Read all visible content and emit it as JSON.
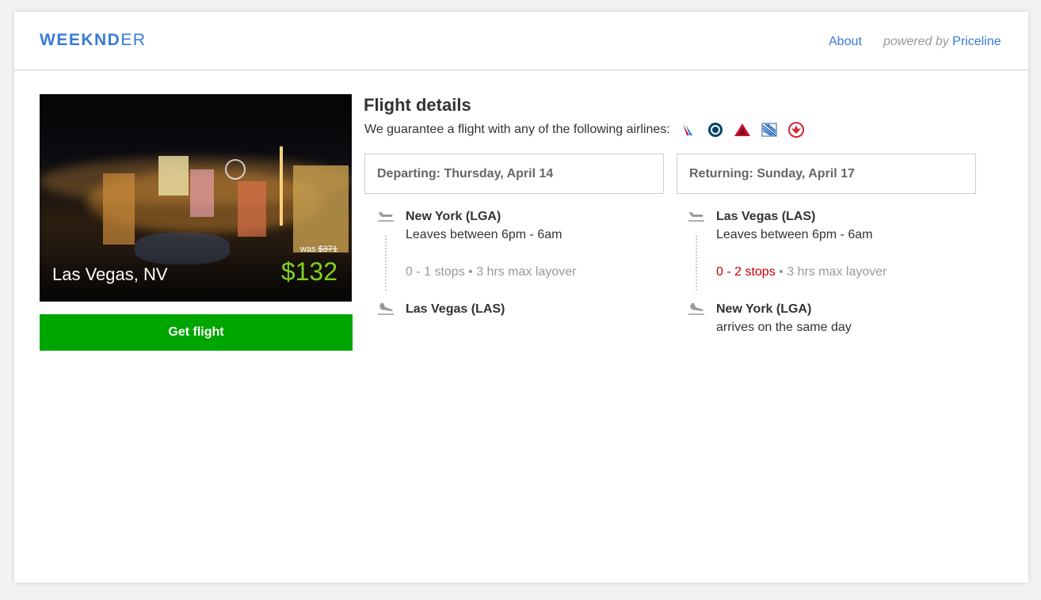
{
  "header": {
    "logo_bold": "WEEKND",
    "logo_light": "ER",
    "about_label": "About",
    "powered_by_prefix": "powered by",
    "powered_by_brand": "Priceline"
  },
  "deal": {
    "city": "Las Vegas, NV",
    "was_label": "was",
    "was_price": "$371",
    "price": "$132",
    "cta_label": "Get flight"
  },
  "flight_details": {
    "title": "Flight details",
    "guarantee_text": "We guarantee a flight with any of the following airlines:",
    "airline_icons": [
      "american-airlines-icon",
      "alaska-airlines-icon",
      "delta-icon",
      "united-icon",
      "air-canada-icon"
    ]
  },
  "departing": {
    "header": "Departing: Thursday, April 14",
    "origin": "New York (LGA)",
    "leaves": "Leaves between 6pm - 6am",
    "stops": "0 - 1 stops",
    "layover": " • 3 hrs max layover",
    "destination": "Las Vegas (LAS)"
  },
  "returning": {
    "header": "Returning: Sunday, April 17",
    "origin": "Las Vegas (LAS)",
    "leaves": "Leaves between 6pm - 6am",
    "stops": "0 - 2 stops",
    "layover": " • 3 hrs max layover",
    "destination": "New York (LGA)",
    "arrival_note": "arrives on the same day"
  },
  "colors": {
    "brand_blue": "#3a7bd5",
    "cta_green": "#00a600",
    "price_green": "#7ed321",
    "stops_warning_red": "#cc0000"
  }
}
